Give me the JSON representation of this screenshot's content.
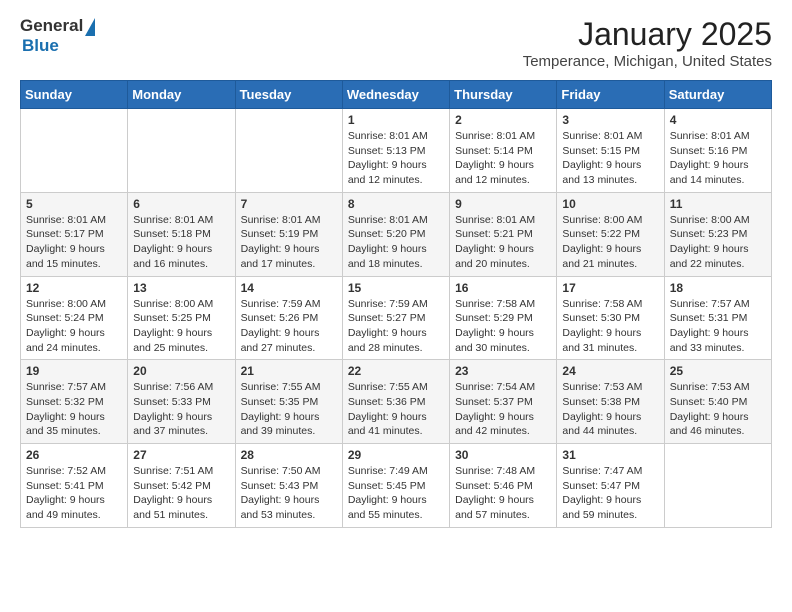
{
  "header": {
    "logo_general": "General",
    "logo_blue": "Blue",
    "month_title": "January 2025",
    "location": "Temperance, Michigan, United States"
  },
  "days_of_week": [
    "Sunday",
    "Monday",
    "Tuesday",
    "Wednesday",
    "Thursday",
    "Friday",
    "Saturday"
  ],
  "weeks": [
    [
      {
        "day": "",
        "info": ""
      },
      {
        "day": "",
        "info": ""
      },
      {
        "day": "",
        "info": ""
      },
      {
        "day": "1",
        "info": "Sunrise: 8:01 AM\nSunset: 5:13 PM\nDaylight: 9 hours\nand 12 minutes."
      },
      {
        "day": "2",
        "info": "Sunrise: 8:01 AM\nSunset: 5:14 PM\nDaylight: 9 hours\nand 12 minutes."
      },
      {
        "day": "3",
        "info": "Sunrise: 8:01 AM\nSunset: 5:15 PM\nDaylight: 9 hours\nand 13 minutes."
      },
      {
        "day": "4",
        "info": "Sunrise: 8:01 AM\nSunset: 5:16 PM\nDaylight: 9 hours\nand 14 minutes."
      }
    ],
    [
      {
        "day": "5",
        "info": "Sunrise: 8:01 AM\nSunset: 5:17 PM\nDaylight: 9 hours\nand 15 minutes."
      },
      {
        "day": "6",
        "info": "Sunrise: 8:01 AM\nSunset: 5:18 PM\nDaylight: 9 hours\nand 16 minutes."
      },
      {
        "day": "7",
        "info": "Sunrise: 8:01 AM\nSunset: 5:19 PM\nDaylight: 9 hours\nand 17 minutes."
      },
      {
        "day": "8",
        "info": "Sunrise: 8:01 AM\nSunset: 5:20 PM\nDaylight: 9 hours\nand 18 minutes."
      },
      {
        "day": "9",
        "info": "Sunrise: 8:01 AM\nSunset: 5:21 PM\nDaylight: 9 hours\nand 20 minutes."
      },
      {
        "day": "10",
        "info": "Sunrise: 8:00 AM\nSunset: 5:22 PM\nDaylight: 9 hours\nand 21 minutes."
      },
      {
        "day": "11",
        "info": "Sunrise: 8:00 AM\nSunset: 5:23 PM\nDaylight: 9 hours\nand 22 minutes."
      }
    ],
    [
      {
        "day": "12",
        "info": "Sunrise: 8:00 AM\nSunset: 5:24 PM\nDaylight: 9 hours\nand 24 minutes."
      },
      {
        "day": "13",
        "info": "Sunrise: 8:00 AM\nSunset: 5:25 PM\nDaylight: 9 hours\nand 25 minutes."
      },
      {
        "day": "14",
        "info": "Sunrise: 7:59 AM\nSunset: 5:26 PM\nDaylight: 9 hours\nand 27 minutes."
      },
      {
        "day": "15",
        "info": "Sunrise: 7:59 AM\nSunset: 5:27 PM\nDaylight: 9 hours\nand 28 minutes."
      },
      {
        "day": "16",
        "info": "Sunrise: 7:58 AM\nSunset: 5:29 PM\nDaylight: 9 hours\nand 30 minutes."
      },
      {
        "day": "17",
        "info": "Sunrise: 7:58 AM\nSunset: 5:30 PM\nDaylight: 9 hours\nand 31 minutes."
      },
      {
        "day": "18",
        "info": "Sunrise: 7:57 AM\nSunset: 5:31 PM\nDaylight: 9 hours\nand 33 minutes."
      }
    ],
    [
      {
        "day": "19",
        "info": "Sunrise: 7:57 AM\nSunset: 5:32 PM\nDaylight: 9 hours\nand 35 minutes."
      },
      {
        "day": "20",
        "info": "Sunrise: 7:56 AM\nSunset: 5:33 PM\nDaylight: 9 hours\nand 37 minutes."
      },
      {
        "day": "21",
        "info": "Sunrise: 7:55 AM\nSunset: 5:35 PM\nDaylight: 9 hours\nand 39 minutes."
      },
      {
        "day": "22",
        "info": "Sunrise: 7:55 AM\nSunset: 5:36 PM\nDaylight: 9 hours\nand 41 minutes."
      },
      {
        "day": "23",
        "info": "Sunrise: 7:54 AM\nSunset: 5:37 PM\nDaylight: 9 hours\nand 42 minutes."
      },
      {
        "day": "24",
        "info": "Sunrise: 7:53 AM\nSunset: 5:38 PM\nDaylight: 9 hours\nand 44 minutes."
      },
      {
        "day": "25",
        "info": "Sunrise: 7:53 AM\nSunset: 5:40 PM\nDaylight: 9 hours\nand 46 minutes."
      }
    ],
    [
      {
        "day": "26",
        "info": "Sunrise: 7:52 AM\nSunset: 5:41 PM\nDaylight: 9 hours\nand 49 minutes."
      },
      {
        "day": "27",
        "info": "Sunrise: 7:51 AM\nSunset: 5:42 PM\nDaylight: 9 hours\nand 51 minutes."
      },
      {
        "day": "28",
        "info": "Sunrise: 7:50 AM\nSunset: 5:43 PM\nDaylight: 9 hours\nand 53 minutes."
      },
      {
        "day": "29",
        "info": "Sunrise: 7:49 AM\nSunset: 5:45 PM\nDaylight: 9 hours\nand 55 minutes."
      },
      {
        "day": "30",
        "info": "Sunrise: 7:48 AM\nSunset: 5:46 PM\nDaylight: 9 hours\nand 57 minutes."
      },
      {
        "day": "31",
        "info": "Sunrise: 7:47 AM\nSunset: 5:47 PM\nDaylight: 9 hours\nand 59 minutes."
      },
      {
        "day": "",
        "info": ""
      }
    ]
  ]
}
